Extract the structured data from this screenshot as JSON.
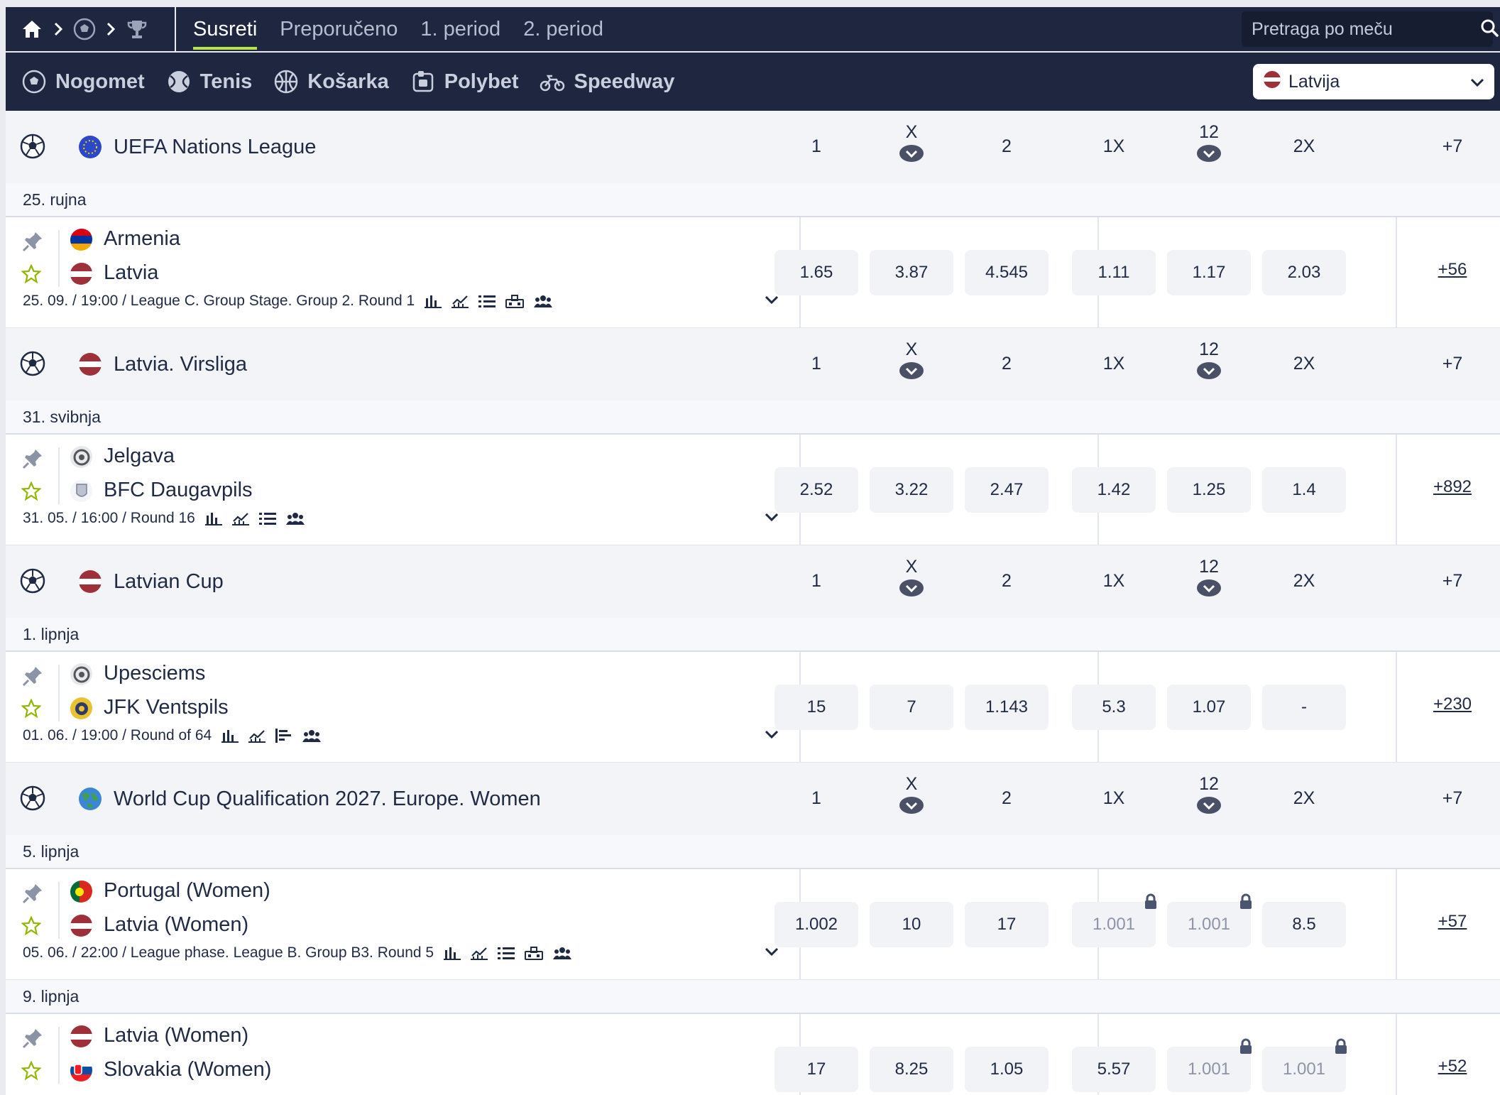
{
  "nav": {
    "tabs": [
      "Susreti",
      "Preporučeno",
      "1. period",
      "2. period"
    ],
    "search_placeholder": "Pretraga po meču"
  },
  "sports": [
    {
      "label": "Nogomet",
      "icon": "soccer-ball-icon"
    },
    {
      "label": "Tenis",
      "icon": "tennis-ball-icon"
    },
    {
      "label": "Košarka",
      "icon": "basketball-icon"
    },
    {
      "label": "Polybet",
      "icon": "polybet-icon"
    },
    {
      "label": "Speedway",
      "icon": "motorbike-icon"
    }
  ],
  "country_select": {
    "value": "Latvija"
  },
  "columns": [
    "1",
    "X",
    "2",
    "1X",
    "12",
    "2X"
  ],
  "colors": {
    "nav_bg": "#1e2640",
    "accent": "#b7e34a",
    "odd_bg": "#f1f3f7"
  },
  "leagues": [
    {
      "name": "UEFA Nations League",
      "more": "+7",
      "flag": "eu",
      "date": "25. rujna",
      "matches": [
        {
          "home": "Armenia",
          "away": "Latvia",
          "home_flag": "am",
          "away_flag": "lv",
          "meta": "25. 09. / 19:00 / League C. Group Stage. Group 2. Round 1",
          "icons": [
            "stats-icon",
            "chart-icon",
            "list-icon",
            "lineup-icon",
            "teams-icon"
          ],
          "odds": [
            "1.65",
            "3.87",
            "4.545",
            "1.11",
            "1.17",
            "2.03"
          ],
          "locked": [
            false,
            false,
            false,
            false,
            false,
            false
          ],
          "more": "+56"
        }
      ]
    },
    {
      "name": "Latvia. Virsliga",
      "more": "+7",
      "flag": "lv",
      "date": "31. svibnja",
      "matches": [
        {
          "home": "Jelgava",
          "away": "BFC Daugavpils",
          "home_flag": "club",
          "away_flag": "club2",
          "meta": "31. 05. / 16:00 / Round 16",
          "icons": [
            "stats-icon",
            "chart-icon",
            "list-icon",
            "teams-icon"
          ],
          "odds": [
            "2.52",
            "3.22",
            "2.47",
            "1.42",
            "1.25",
            "1.4"
          ],
          "locked": [
            false,
            false,
            false,
            false,
            false,
            false
          ],
          "more": "+892"
        }
      ]
    },
    {
      "name": "Latvian Cup",
      "more": "+7",
      "flag": "lv",
      "date": "1. lipnja",
      "matches": [
        {
          "home": "Upesciems",
          "away": "JFK Ventspils",
          "home_flag": "club",
          "away_flag": "club3",
          "meta": "01. 06. / 19:00 / Round of 64",
          "icons": [
            "stats-icon",
            "chart-icon",
            "bars-icon",
            "teams-icon"
          ],
          "odds": [
            "15",
            "7",
            "1.143",
            "5.3",
            "1.07",
            "-"
          ],
          "locked": [
            false,
            false,
            false,
            false,
            false,
            false
          ],
          "more": "+230"
        }
      ]
    },
    {
      "name": "World Cup Qualification 2027. Europe. Women",
      "more": "+7",
      "flag": "world",
      "date": "5. lipnja",
      "matches": [
        {
          "home": "Portugal (Women)",
          "away": "Latvia (Women)",
          "home_flag": "pt",
          "away_flag": "lv",
          "meta": "05. 06. / 22:00 / League phase. League B. Group B3. Round 5",
          "icons": [
            "stats-icon",
            "chart-icon",
            "list-icon",
            "lineup-icon",
            "teams-icon"
          ],
          "odds": [
            "1.002",
            "10",
            "17",
            "1.001",
            "1.001",
            "8.5"
          ],
          "locked": [
            false,
            false,
            false,
            true,
            true,
            false
          ],
          "more": "+57"
        }
      ],
      "date2": "9. lipnja",
      "matches2": [
        {
          "home": "Latvia (Women)",
          "away": "Slovakia (Women)",
          "home_flag": "lv",
          "away_flag": "sk",
          "odds": [
            "17",
            "8.25",
            "1.05",
            "5.57",
            "1.001",
            "1.001"
          ],
          "locked": [
            false,
            false,
            false,
            false,
            true,
            true
          ],
          "more": "+52"
        }
      ]
    }
  ]
}
